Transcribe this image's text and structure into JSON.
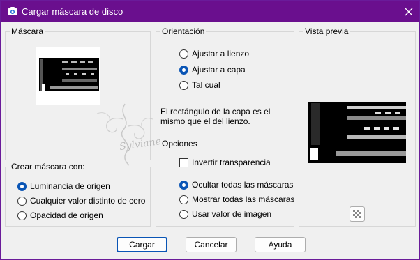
{
  "window": {
    "title": "Cargar máscara de disco",
    "title_color": "#6a0f8e",
    "accent_color": "#0a55b5"
  },
  "mask_group": {
    "label": "Máscara"
  },
  "create_group": {
    "label": "Crear máscara con:",
    "options": [
      {
        "label": "Luminancia de origen",
        "selected": true
      },
      {
        "label": "Cualquier valor distinto de cero",
        "selected": false
      },
      {
        "label": "Opacidad de origen",
        "selected": false
      }
    ]
  },
  "orientation_group": {
    "label": "Orientación",
    "options": [
      {
        "label": "Ajustar a lienzo",
        "selected": false
      },
      {
        "label": "Ajustar a capa",
        "selected": true
      },
      {
        "label": "Tal cual",
        "selected": false
      }
    ],
    "note_line1": "El rectángulo de la capa es el",
    "note_line2": "mismo que el del lienzo."
  },
  "options_group": {
    "label": "Opciones",
    "invert_label": "Invertir transparencia",
    "invert_checked": false,
    "options": [
      {
        "label": "Ocultar todas las máscaras",
        "selected": true
      },
      {
        "label": "Mostrar todas las máscaras",
        "selected": false
      },
      {
        "label": "Usar valor de imagen",
        "selected": false
      }
    ]
  },
  "preview_group": {
    "label": "Vista previa"
  },
  "buttons": {
    "load": "Cargar",
    "cancel": "Cancelar",
    "help": "Ayuda"
  },
  "watermark_text": "Sylviane"
}
